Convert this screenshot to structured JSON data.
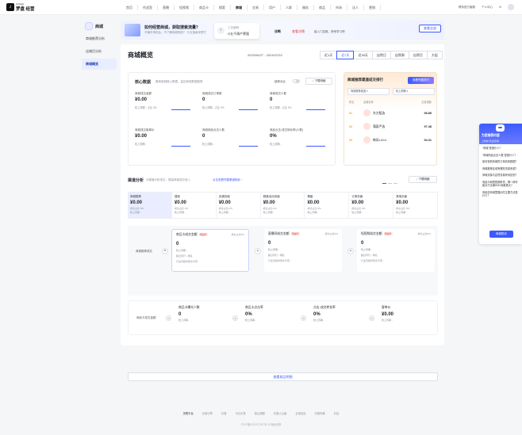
{
  "brand": {
    "small": "抖音电商",
    "name": "罗盘 经营",
    "mark": "♪"
  },
  "nav": [
    "首页",
    "作战室",
    "直播",
    "短视频",
    "商品卡",
    "搜索",
    "商城",
    "交易",
    "用户",
    "人群",
    "服务",
    "商品",
    "市场",
    "达人",
    "营销"
  ],
  "nav_active": "商城",
  "top_right": {
    "contact": "联系官方客服",
    "workspace": "个人中心",
    "bell": "✉"
  },
  "sidebar": {
    "title": "商城",
    "items": [
      "商城推荐分析",
      "店铺页分析",
      "商城概览"
    ],
    "active": "商城概览"
  },
  "banner": {
    "title": "如何经营商城，获取搜索流量？",
    "subtitle": "不懂市场机会，不了解商城规则？ 行业指南来帮忙",
    "card_line1": "三天案例",
    "card_line2": "G五千周产界面",
    "question": "诊断",
    "link": "查看详情",
    "tip": "接入门店推，快来学习吧",
    "button": "查看全部"
  },
  "header": {
    "title": "商城概览",
    "date_range": "2023/06/27 - 2023/07/03",
    "ranges": [
      "近1天",
      "近7天",
      "近30天",
      "自然日",
      "自然周",
      "自然月",
      "大促"
    ],
    "active_range": "近7天"
  },
  "core": {
    "title": "核心数据",
    "subtitle": "展现商城核心数据，监控商城数据趋势",
    "compare_label": "趋势对比",
    "download": "↓ 下载明细",
    "metrics": [
      {
        "label": "商城成交金额",
        "value": "¥0.00",
        "foot": "较上周期 -    占比 0%"
      },
      {
        "label": "商城成交订单数",
        "value": "0",
        "foot": "较上周期 -    占比 0%"
      },
      {
        "label": "商城成交人数",
        "value": "0",
        "foot": "较上周期 -    占比 0%"
      },
      {
        "label": "商城成交客单价",
        "value": "¥0.00",
        "foot": "较上周期 -"
      },
      {
        "label": "商城商品点击人数",
        "value": "0",
        "foot": "较上周期 -"
      },
      {
        "label": "商品点击-成交转化率(人数)",
        "value": "0%",
        "foot": "较上周期 -"
      }
    ]
  },
  "rank": {
    "title": "商城推荐渠道成交排行",
    "hot_button": "查看完整排行",
    "select1": "商城推荐渠道 ▾",
    "select2": "较上周期 ▾",
    "head": [
      "排名",
      "店铺名称",
      "交易指数"
    ],
    "rows": [
      {
        "no": "01",
        "name": "东方甄选",
        "value": "98.85"
      },
      {
        "no": "02",
        "name": "蒲惠严选",
        "value": "97.48"
      },
      {
        "no": "03",
        "name": "韩风LULU",
        "value": "94.31"
      }
    ]
  },
  "channel": {
    "title": "渠道分析",
    "subtitle": "分渠道分析成交，提高商城成交收入",
    "link": "点击查看完整渠道指标 ›",
    "download": "↓ 下载明细",
    "items": [
      {
        "name": "商城推荐",
        "value": "¥0.00",
        "share": "成交占比 0%",
        "foot": "较上周期 -"
      },
      {
        "name": "搜索",
        "value": "¥0.00",
        "share": "成交占比 0%",
        "foot": "较上周期 -"
      },
      {
        "name": "店铺页面",
        "value": "¥0.00",
        "share": "成交占比 0%",
        "foot": "较上周期 -"
      },
      {
        "name": "频道活动页面",
        "value": "¥0.00",
        "share": "成交占比 0%",
        "foot": "较上周期 -"
      },
      {
        "name": "橱窗",
        "value": "¥0.00",
        "share": "成交占比 0%",
        "foot": "较上周期 -"
      },
      {
        "name": "订单页面",
        "value": "¥0.00",
        "share": "成交占比 0%",
        "foot": "较上周期 -"
      },
      {
        "name": "其他页面",
        "value": "¥0.00",
        "share": "成交占比 0%",
        "foot": "较上周期 -"
      }
    ]
  },
  "flow": {
    "label": "商城推荐成交",
    "op_eq": "=",
    "op_plus": "+",
    "cards": [
      {
        "title": "商品卡成交金额",
        "tag": "待提升",
        "share": "成交占比0%",
        "value": "0",
        "l1": "较上周期 -",
        "l2": "超过同行 -  排名",
        "l3": "行业同级商家水平值 -"
      },
      {
        "title": "直播间成交金额",
        "tag": "待提升",
        "share": "成交占比0%",
        "value": "0",
        "l1": "较上周期 -",
        "l2": "超过同行 -  排名",
        "l3": "行业同级商家水平值 -"
      },
      {
        "title": "短视频成交金额",
        "tag": "待提升",
        "share": "成交占比0%",
        "value": "0",
        "l1": "较上周期 -",
        "l2": "超过同行 -  排名",
        "l3": "行业同级商家水平值 -"
      }
    ]
  },
  "flow2": {
    "label": "商品卡成交金额",
    "op_eq": "=",
    "op_x": "×",
    "items": [
      {
        "title": "商品卡曝光人数",
        "value": "0",
        "foot": "较上周期 -"
      },
      {
        "title": "商品卡点击率",
        "value": "0%",
        "foot": "较上周期 -"
      },
      {
        "title": "点击-成交转化率",
        "value": "0%",
        "foot": "较上周期 -"
      },
      {
        "title": "客单价",
        "value": "¥0.00",
        "foot": "较上周期 -"
      }
    ]
  },
  "more_button": "查看商品明细",
  "assistant": {
    "title": "为您推荐内容",
    "greeting": "上新前 欢迎咨询",
    "questions": [
      "“商城”是指什么？",
      "“商城商品点击人数”是指什么？",
      "如何查看商城的订单具体数据？",
      "商城推荐区域有哪些流量来源？",
      "商城流量与自然流量有何区别？",
      "商品卡和短视频带货，哪一种可能对于店铺GMV贡献更大？",
      "商品在商城里展示的主要方法是什么？"
    ],
    "button": "商城助手"
  },
  "footer": {
    "links": [
      "关联平台",
      "巨量引擎",
      "抖音",
      "今日头条",
      "西瓜视频",
      "抖音火山版",
      "巨量百应",
      "抖音商城",
      "抖店"
    ],
    "icp": "沪ICP备2021017387号-19    隐私政策"
  }
}
